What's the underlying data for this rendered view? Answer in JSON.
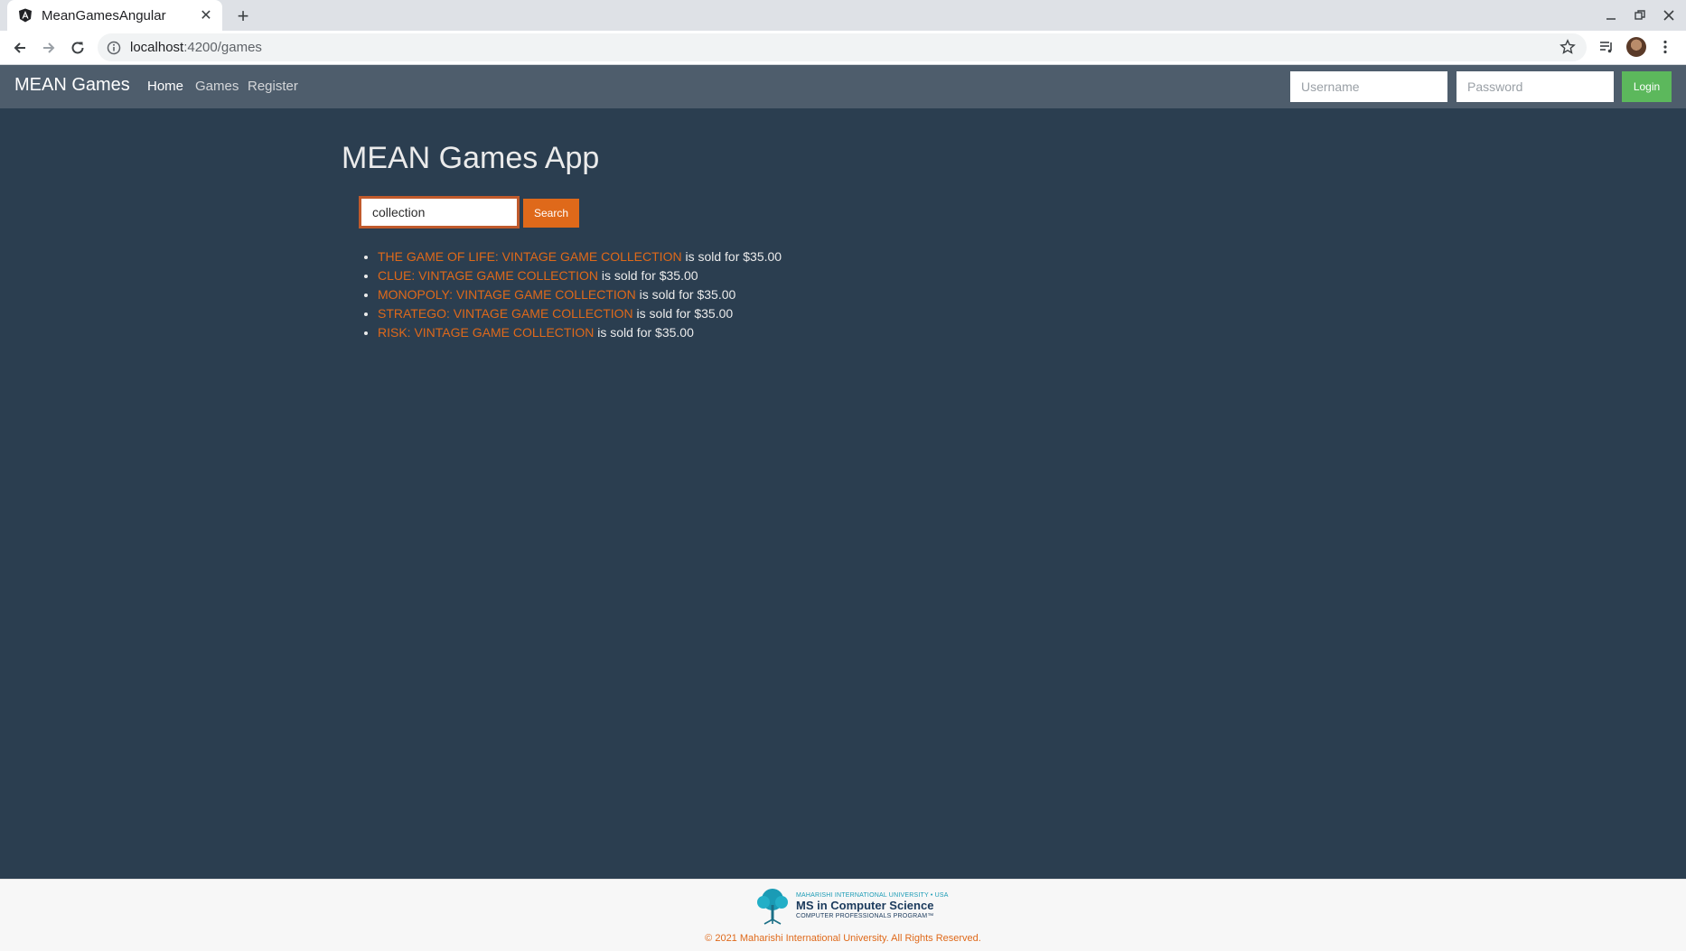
{
  "browser": {
    "tab_title": "MeanGamesAngular",
    "url_host": "localhost",
    "url_path": ":4200/games"
  },
  "navbar": {
    "brand": "MEAN Games",
    "links": [
      "Home",
      "Games",
      "Register"
    ],
    "active_link": "Home",
    "username_placeholder": "Username",
    "password_placeholder": "Password",
    "login_label": "Login"
  },
  "main": {
    "title": "MEAN Games App",
    "search_value": "collection",
    "search_button": "Search",
    "results": [
      {
        "name": "THE GAME OF LIFE: VINTAGE GAME COLLECTION",
        "suffix": " is sold for $35.00"
      },
      {
        "name": "CLUE: VINTAGE GAME COLLECTION",
        "suffix": " is sold for $35.00"
      },
      {
        "name": "MONOPOLY: VINTAGE GAME COLLECTION",
        "suffix": " is sold for $35.00"
      },
      {
        "name": "STRATEGO: VINTAGE GAME COLLECTION",
        "suffix": " is sold for $35.00"
      },
      {
        "name": "RISK: VINTAGE GAME COLLECTION",
        "suffix": " is sold for $35.00"
      }
    ]
  },
  "footer": {
    "logo_top": "MAHARISHI INTERNATIONAL UNIVERSITY • USA",
    "logo_main": "MS in Computer Science",
    "logo_sub": "COMPUTER PROFESSIONALS PROGRAM™",
    "copyright": "© 2021 Maharishi International University. All Rights Reserved."
  },
  "colors": {
    "page_bg": "#2b3e50",
    "navbar_bg": "#4e5d6c",
    "accent": "#df691a",
    "login_green": "#5cb85c"
  }
}
